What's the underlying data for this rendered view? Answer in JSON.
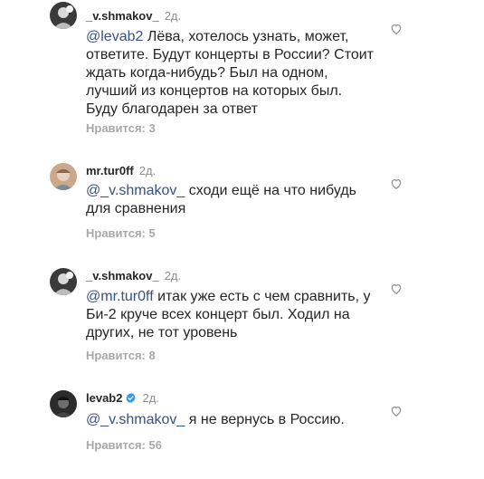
{
  "comments": [
    {
      "username": "_v.shmakov_",
      "time": "2д.",
      "mention": "@levab2",
      "text": " Лёва, хотелось узнать, может, ответите. Будут концерты в России? Стоит ждать когда-нибудь? Был на одном, лучший из концертов на которых был. Буду благодарен за ответ",
      "likes": "Нравится: 3",
      "verified": false
    },
    {
      "username": "mr.tur0ff",
      "time": "2д.",
      "mention": "@_v.shmakov_",
      "text": " сходи ещё на что нибудь для сравнения",
      "likes": "Нравится: 5",
      "verified": false
    },
    {
      "username": "_v.shmakov_",
      "time": "2д.",
      "mention": "@mr.tur0ff",
      "text": " итак уже есть с чем сравнить, у Би-2 круче всех концерт был. Ходил на других, не тот уровень",
      "likes": "Нравится: 8",
      "verified": false
    },
    {
      "username": "levab2",
      "time": "2д.",
      "mention": "@_v.shmakov_",
      "text": " я не вернусь в Россию.",
      "likes": "Нравится: 56",
      "verified": true
    }
  ],
  "colors": {
    "mention": "#385185",
    "verified": "#3897f0",
    "muted": "#8e8e8e"
  },
  "icons": {
    "like": "heart-outline-icon",
    "verified": "verified-badge-icon"
  }
}
